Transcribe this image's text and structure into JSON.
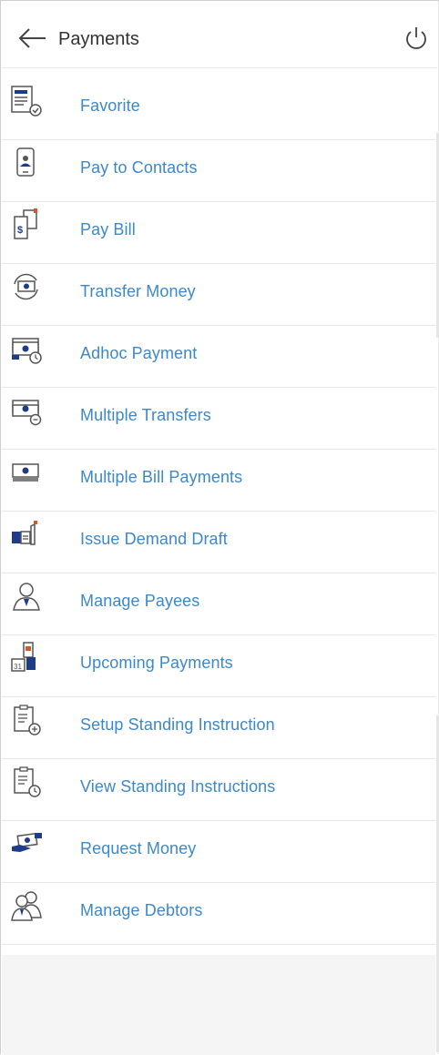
{
  "header": {
    "title": "Payments",
    "back_icon": "arrow-left-icon",
    "power_icon": "power-icon"
  },
  "menu": [
    {
      "label": "Favorite",
      "icon": "favorite-document-icon"
    },
    {
      "label": "Pay to Contacts",
      "icon": "phone-contact-icon"
    },
    {
      "label": "Pay Bill",
      "icon": "bill-dollar-icon"
    },
    {
      "label": "Transfer Money",
      "icon": "transfer-cycle-icon"
    },
    {
      "label": "Adhoc Payment",
      "icon": "cash-clock-icon"
    },
    {
      "label": "Multiple Transfers",
      "icon": "cash-stack-icon"
    },
    {
      "label": "Multiple Bill Payments",
      "icon": "cash-bill-icon"
    },
    {
      "label": "Issue Demand Draft",
      "icon": "demand-draft-icon"
    },
    {
      "label": "Manage Payees",
      "icon": "payee-person-icon"
    },
    {
      "label": "Upcoming Payments",
      "icon": "calendar-payment-icon"
    },
    {
      "label": "Setup Standing Instruction",
      "icon": "clipboard-add-icon"
    },
    {
      "label": "View Standing Instructions",
      "icon": "clipboard-clock-icon"
    },
    {
      "label": "Request Money",
      "icon": "hand-cash-icon"
    },
    {
      "label": "Manage Debtors",
      "icon": "debtors-people-icon"
    }
  ]
}
